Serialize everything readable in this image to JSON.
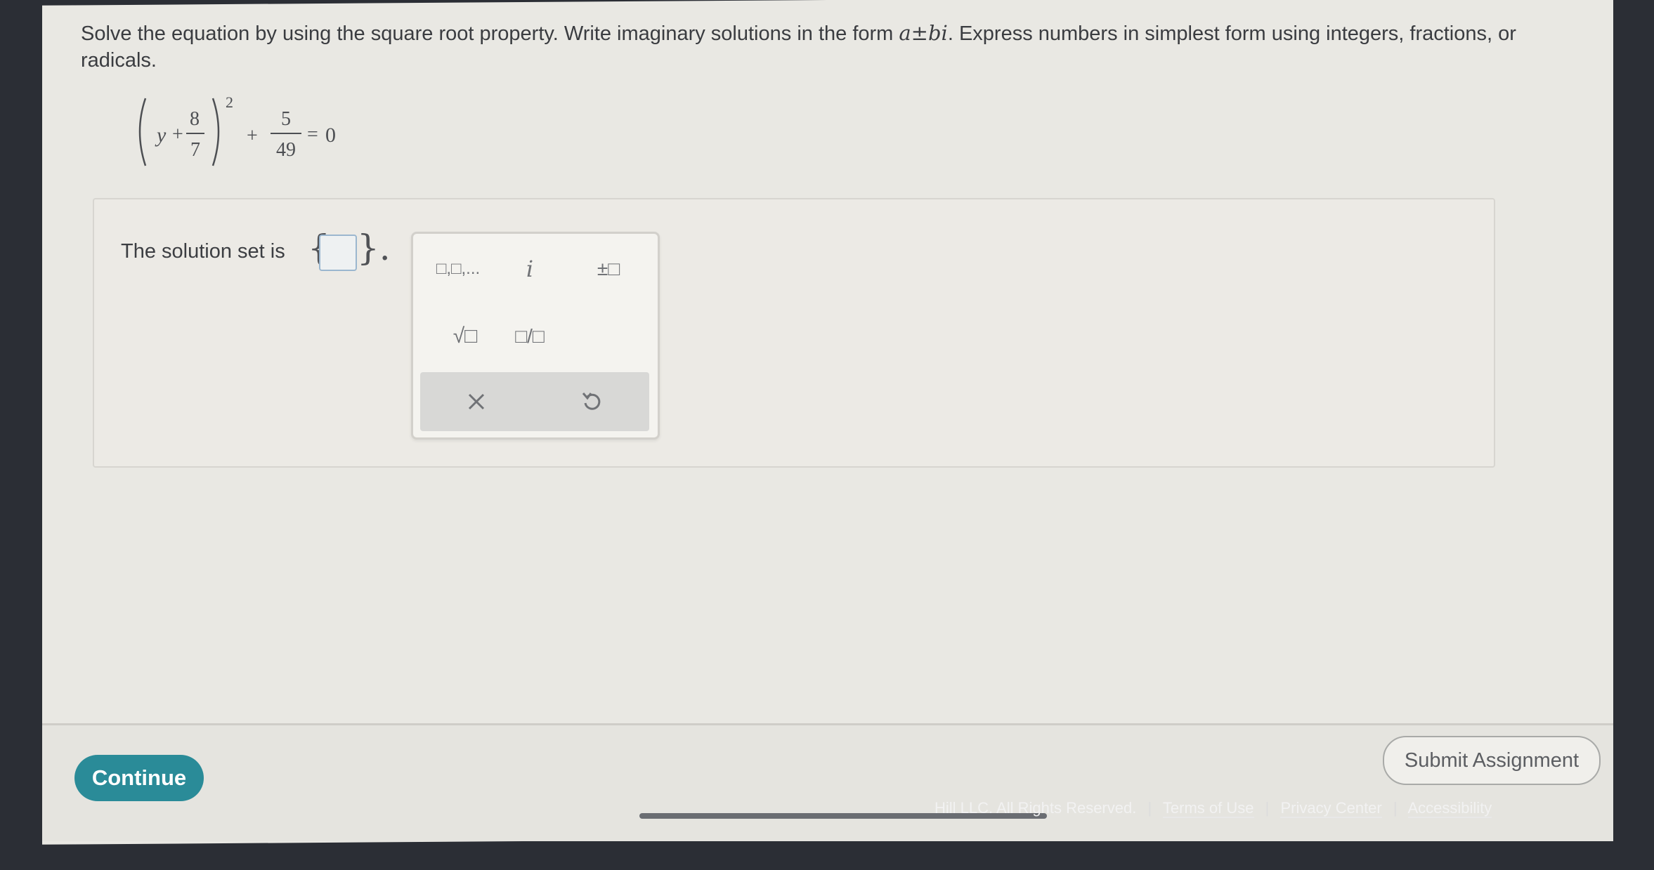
{
  "instructions": {
    "part1": "Solve the equation by using the square root property. Write imaginary solutions in the form ",
    "form": "a±bi",
    "part2": ". Express numbers in simplest form using integers, fractions, or radicals."
  },
  "equation": {
    "variable": "y",
    "plus1": "+",
    "frac1_num": "8",
    "frac1_den": "7",
    "exponent": "2",
    "plus2": "+",
    "frac2_num": "5",
    "frac2_den": "49",
    "equals": "=",
    "rhs": "0"
  },
  "answer": {
    "label": "The solution set is",
    "value": "",
    "brace_open": "{",
    "brace_close": "}.",
    "period": "."
  },
  "palette": {
    "list_label": "□,□,...",
    "imaginary_label": "i",
    "plus_minus_label": "±□",
    "sqrt_label": "√□",
    "fraction_label": "□/□",
    "clear_icon": "close-icon",
    "undo_icon": "undo-icon"
  },
  "footer": {
    "continue_label": "Continue",
    "submit_label": "Submit Assignment",
    "copyright": "Hill LLC. All Rights Reserved.",
    "links": [
      "Terms of Use",
      "Privacy Center",
      "Accessibility"
    ],
    "separator": "|"
  },
  "colors": {
    "accent": "#2a8b98",
    "answer_box_border": "#9bb7cf"
  }
}
